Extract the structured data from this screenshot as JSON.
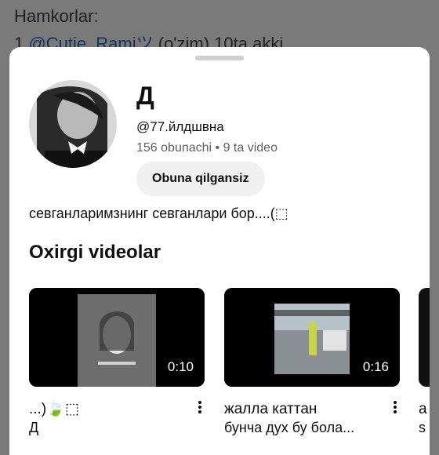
{
  "background": {
    "line1": "Hamkorlar:",
    "line2_prefix": "1.",
    "line2_mention": "@Cutie_Ramiツ",
    "line2_rest": "(o'zim) 10ta akki"
  },
  "channel": {
    "name": "Д",
    "handle": "@77.йлдшвна",
    "stats": "156 obunachi • 9 ta video",
    "subscribe_label": "Obuna qilgansiz",
    "description": "севганларимзнинг севганлари бор....(⬚"
  },
  "section_title": "Oxirgi videolar",
  "videos": [
    {
      "duration": "0:10",
      "title": "...)🍃⬚",
      "subtitle": "Д"
    },
    {
      "duration": "0:16",
      "title": "жалла каттан",
      "subtitle": "бунча дух бу бола..."
    },
    {
      "title": "a",
      "subtitle": "s"
    }
  ],
  "icons": {
    "more": "more-vert-icon"
  }
}
